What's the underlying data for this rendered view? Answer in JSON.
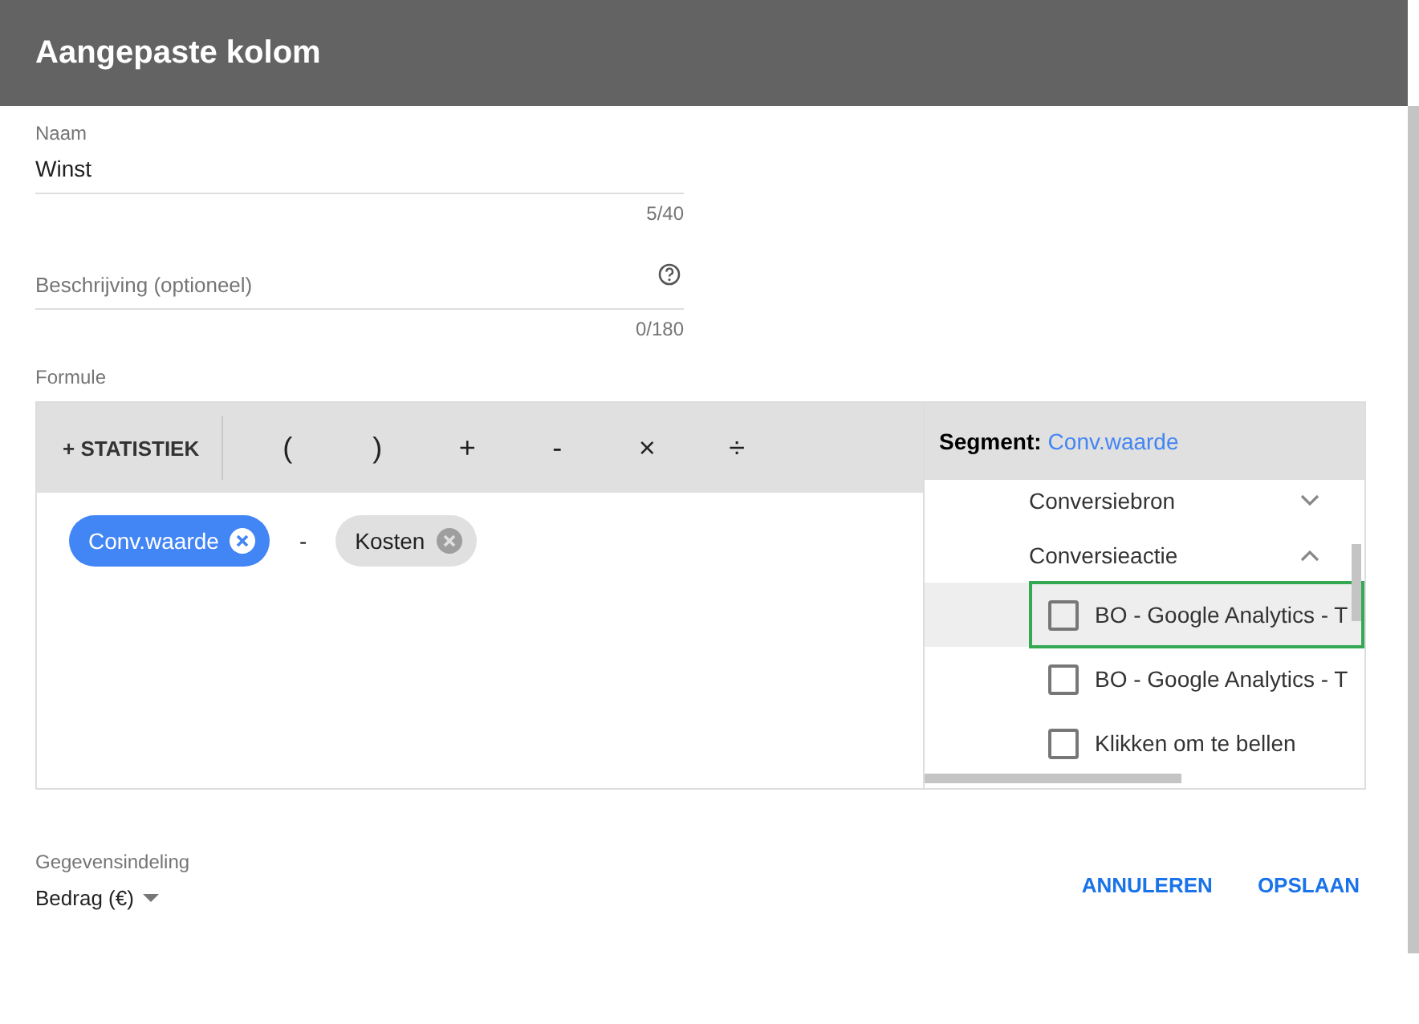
{
  "window": {
    "title": "Aangepaste kolom"
  },
  "name_field": {
    "label": "Naam",
    "value": "Winst",
    "counter": "5/40"
  },
  "description_field": {
    "placeholder": "Beschrijving (optioneel)",
    "counter": "0/180"
  },
  "formula": {
    "label": "Formule",
    "add_button": "+ STATISTIEK",
    "operators": [
      "(",
      ")",
      "+",
      "-",
      "×",
      "÷"
    ],
    "tokens": [
      {
        "kind": "chip",
        "label": "Conv.waarde",
        "selected": true
      },
      {
        "kind": "operator",
        "label": "-"
      },
      {
        "kind": "chip",
        "label": "Kosten",
        "selected": false
      }
    ]
  },
  "segment": {
    "label": "Segment:",
    "value": "Conv.waarde",
    "groups": [
      {
        "label": "Conversiebron",
        "expanded": false
      },
      {
        "label": "Conversieactie",
        "expanded": true,
        "children": [
          {
            "label": "BO - Google Analytics - T",
            "checked": false,
            "selected": true
          },
          {
            "label": "BO - Google Analytics - T",
            "checked": false,
            "selected": false
          },
          {
            "label": "Klikken om te bellen",
            "checked": false,
            "selected": false
          }
        ]
      }
    ]
  },
  "data_format": {
    "label": "Gegevensindeling",
    "value": "Bedrag (€)"
  },
  "buttons": [
    "ANNULEREN",
    "OPSLAAN"
  ]
}
